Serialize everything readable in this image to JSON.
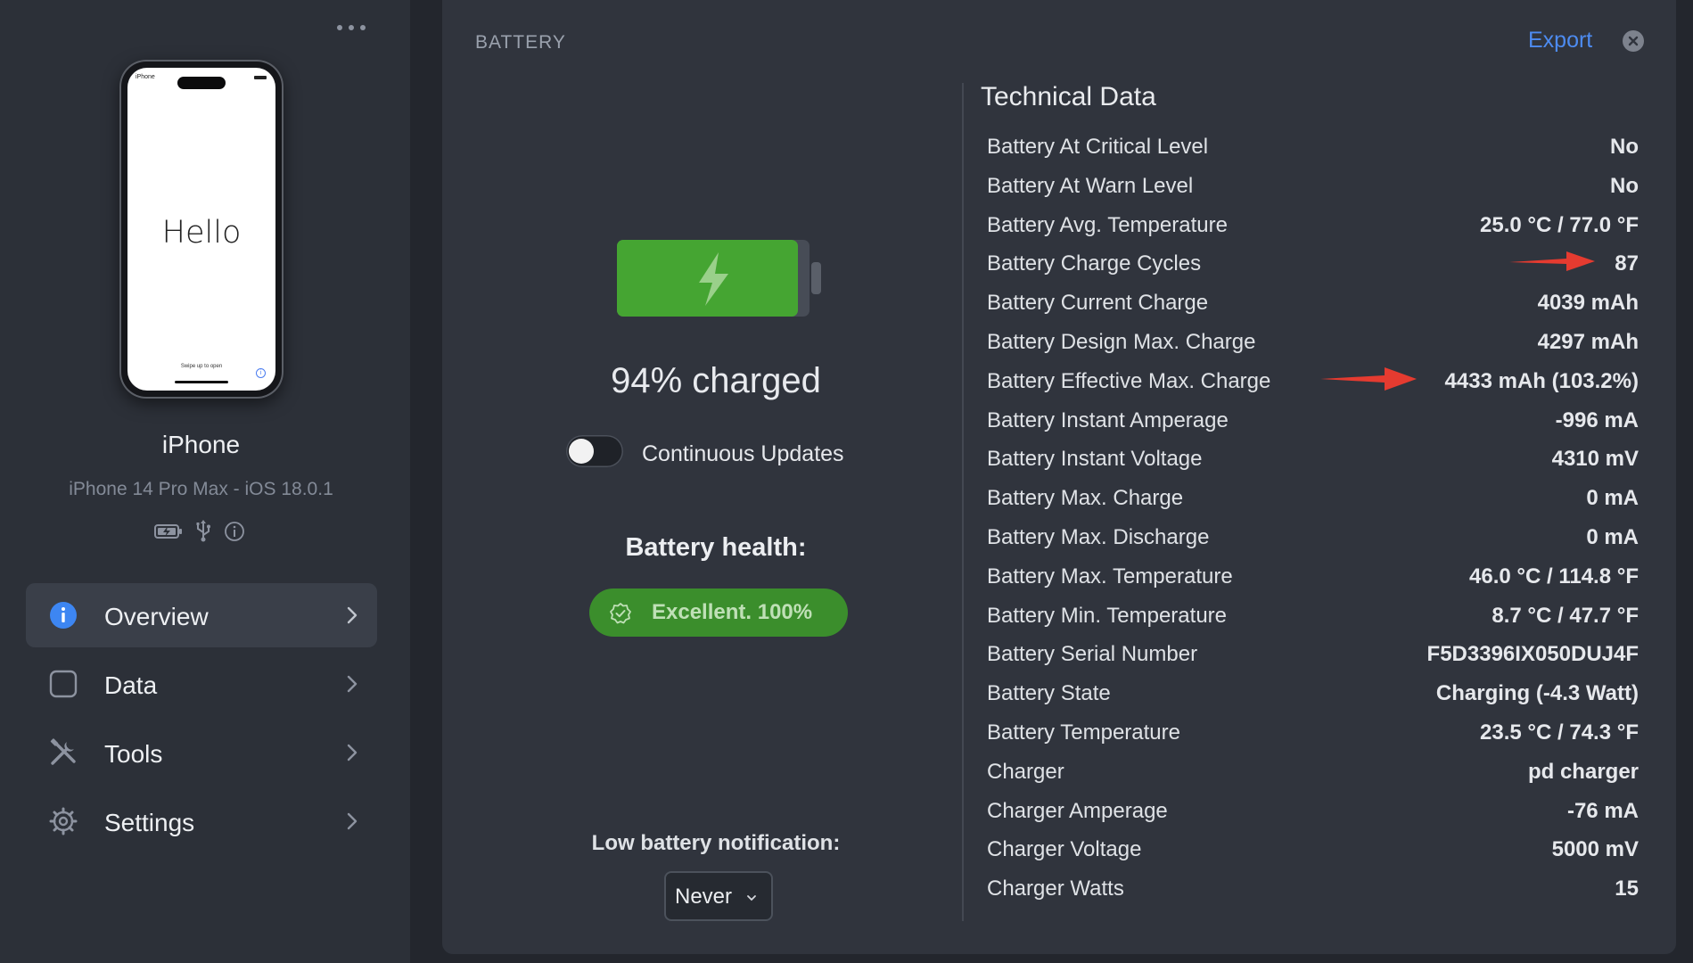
{
  "sidebar": {
    "device_screen": {
      "carrier": "iPhone",
      "greeting": "Hello",
      "swipe_hint": "Swipe up to open"
    },
    "device_name": "iPhone",
    "device_model": "iPhone 14 Pro Max - iOS 18.0.1",
    "status_icons": [
      "battery-charging-icon",
      "usb-icon",
      "info-icon"
    ],
    "nav": [
      {
        "label": "Overview",
        "icon": "info-icon",
        "active": true
      },
      {
        "label": "Data",
        "icon": "square-icon",
        "active": false
      },
      {
        "label": "Tools",
        "icon": "tools-icon",
        "active": false
      },
      {
        "label": "Settings",
        "icon": "gear-icon",
        "active": false
      }
    ]
  },
  "panel": {
    "title": "BATTERY",
    "export_label": "Export",
    "charge_level_percent": 94,
    "charged_text": "94% charged",
    "continuous_updates": {
      "label": "Continuous Updates",
      "enabled": false
    },
    "health": {
      "label": "Battery health:",
      "badge": "Excellent. 100%"
    },
    "low_battery": {
      "label": "Low battery notification:",
      "selected": "Never"
    },
    "technical": {
      "title": "Technical Data",
      "rows": [
        {
          "key": "Battery At Critical Level",
          "value": "No"
        },
        {
          "key": "Battery At Warn Level",
          "value": "No"
        },
        {
          "key": "Battery Avg. Temperature",
          "value": "25.0 °C / 77.0 °F"
        },
        {
          "key": "Battery Charge Cycles",
          "value": "87"
        },
        {
          "key": "Battery Current Charge",
          "value": "4039 mAh"
        },
        {
          "key": "Battery Design Max. Charge",
          "value": "4297 mAh"
        },
        {
          "key": "Battery Effective Max. Charge",
          "value": "4433 mAh (103.2%)"
        },
        {
          "key": "Battery Instant Amperage",
          "value": "-996 mA"
        },
        {
          "key": "Battery Instant Voltage",
          "value": "4310 mV"
        },
        {
          "key": "Battery Max. Charge",
          "value": "0 mA"
        },
        {
          "key": "Battery Max. Discharge",
          "value": "0 mA"
        },
        {
          "key": "Battery Max. Temperature",
          "value": "46.0 °C / 114.8 °F"
        },
        {
          "key": "Battery Min. Temperature",
          "value": "8.7 °C / 47.7 °F"
        },
        {
          "key": "Battery Serial Number",
          "value": "F5D3396IX050DUJ4F"
        },
        {
          "key": "Battery State",
          "value": "Charging (-4.3 Watt)"
        },
        {
          "key": "Battery Temperature",
          "value": "23.5 °C / 74.3 °F"
        },
        {
          "key": "Charger",
          "value": "pd charger"
        },
        {
          "key": "Charger Amperage",
          "value": "-76 mA"
        },
        {
          "key": "Charger Voltage",
          "value": "5000 mV"
        },
        {
          "key": "Charger Watts",
          "value": "15"
        }
      ]
    }
  },
  "colors": {
    "accent": "#4d8bf0",
    "battery_green": "#45a532",
    "health_badge": "#3b8e2c",
    "annotation_arrow": "#e53b30"
  }
}
